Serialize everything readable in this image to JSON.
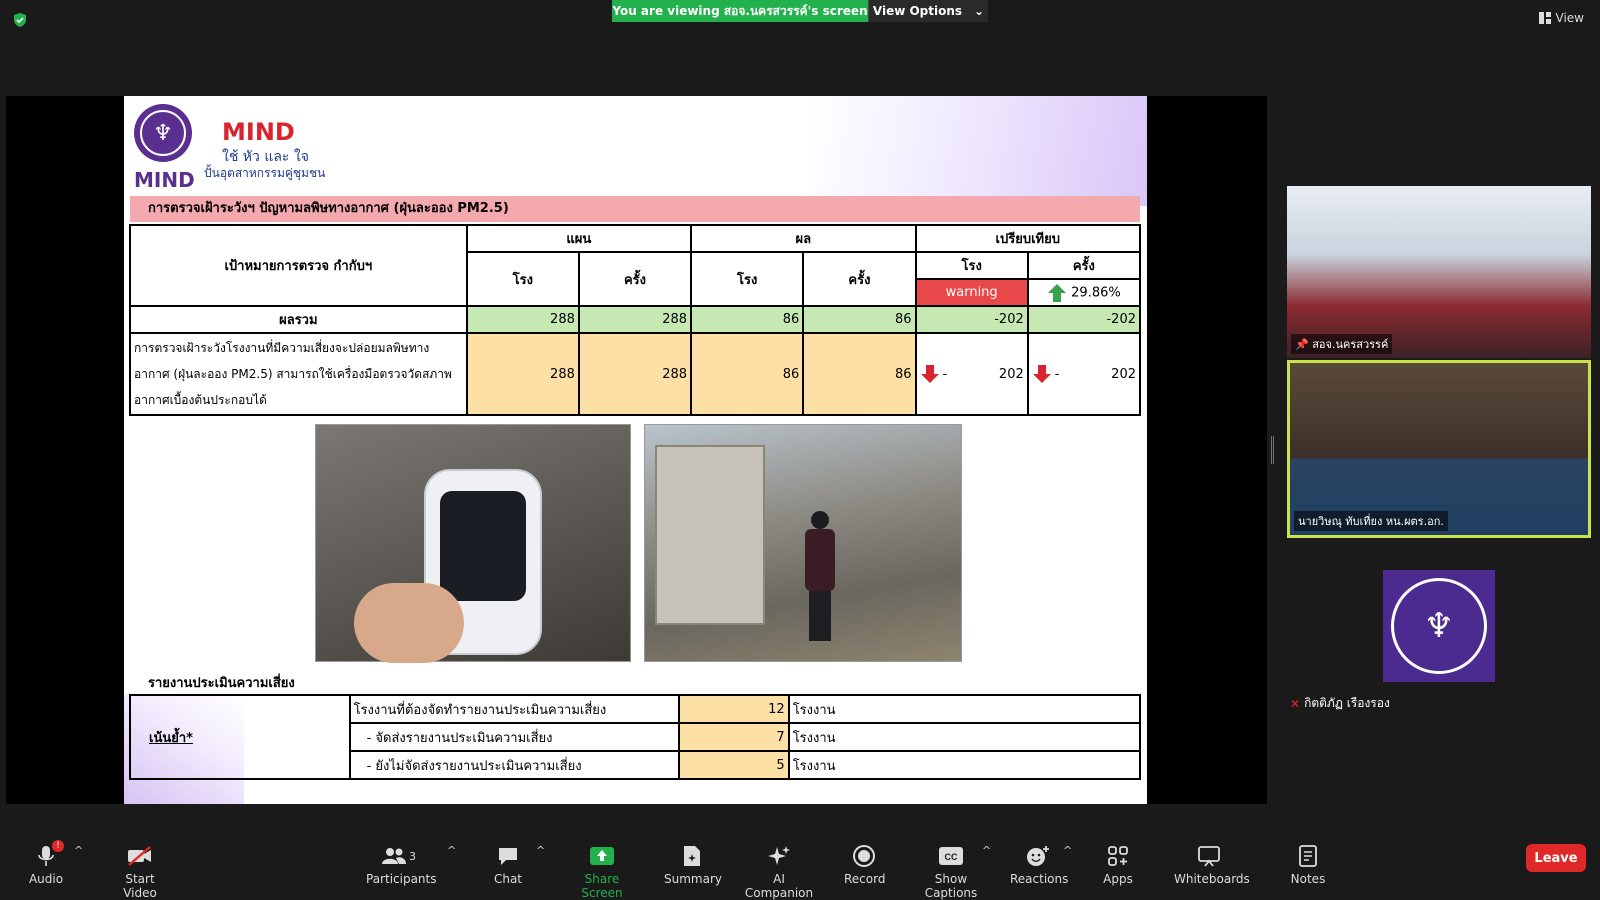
{
  "topbar": {
    "viewing_text": "You are viewing สอจ.นครสวรรค์'s screen",
    "view_options_label": "View Options",
    "view_label": "View"
  },
  "slide": {
    "logo_word": "MIND",
    "brand_title": "MIND",
    "brand_sub1": "ใช้ หัว และ ใจ",
    "brand_sub2": "ปั้นอุตสาหกรรมคู่ชุมชน",
    "section_title": "การตรวจเฝ้าระวังฯ ปัญหามลพิษทางอากาศ (ฝุ่นละออง PM2.5)",
    "table": {
      "target_header": "เป้าหมายการตรวจ กำกับฯ",
      "plan_header": "แผน",
      "result_header": "ผล",
      "compare_header": "เปรียบเทียบ",
      "col_factory": "โรง",
      "col_times": "ครั้ง",
      "compare_factory_status": "warning",
      "compare_times_pct": "29.86%",
      "total_label": "ผลรวม",
      "total_values": [
        "288",
        "288",
        "86",
        "86",
        "-202",
        "-202"
      ],
      "row_label": "การตรวจเฝ้าระวังโรงงานที่มีความเสี่ยงจะปล่อยมลพิษทางอากาศ (ฝุ่นละออง PM2.5) สามารถใช้เครื่องมือตรวจวัดสภาพอากาศเบื้องต้นประกอบได้",
      "row_values": [
        "288",
        "288",
        "86",
        "86"
      ],
      "row_compare_dash": "-",
      "row_compare_values": [
        "202",
        "202"
      ]
    },
    "risk_title": "รายงานประเมินความเสี่ยง",
    "risk_emphasis": "เน้นย้ำ*",
    "risk_rows": [
      {
        "label": "โรงงานที่ต้องจัดทำรายงานประเมินความเสี่ยง",
        "value": "12",
        "unit": "โรงงาน"
      },
      {
        "label": "- จัดส่งรายงานประเมินความเสี่ยง",
        "value": "7",
        "unit": "โรงงาน"
      },
      {
        "label": "- ยังไม่จัดส่งรายงานประเมินความเสี่ยง",
        "value": "5",
        "unit": "โรงงาน"
      }
    ]
  },
  "participants": {
    "tile1_name": "สอจ.นครสวรรค์",
    "tile2_name": "นายวิษณุ ทับเที่ยง หน.ผตร.อก.",
    "tile3_name": "กิตติภัฏ เรืองรอง"
  },
  "toolbar": {
    "audio": "Audio",
    "start_video": "Start Video",
    "participants": "Participants",
    "participants_count": "3",
    "chat": "Chat",
    "share_screen": "Share Screen",
    "summary": "Summary",
    "ai_companion": "AI Companion",
    "record": "Record",
    "show_captions": "Show Captions",
    "reactions": "Reactions",
    "apps": "Apps",
    "whiteboards": "Whiteboards",
    "notes": "Notes",
    "leave": "Leave",
    "audio_badge": "!"
  },
  "colors": {
    "share_green": "#22b14c",
    "leave_red": "#e02828",
    "active_speaker": "#c9e44a",
    "section_pink": "#f3a9ae",
    "total_green": "#c6e8b3",
    "row_peach": "#fde0a6",
    "warning_red": "#e9484a"
  },
  "icons": {
    "shield": "shield-icon",
    "view": "view-grid-icon",
    "audio": "microphone-icon",
    "video": "video-off-icon",
    "participants": "participants-icon",
    "chat": "chat-icon",
    "share": "share-screen-icon",
    "summary": "summary-icon",
    "ai": "ai-companion-icon",
    "record": "record-icon",
    "captions": "captions-icon",
    "reactions": "reactions-icon",
    "apps": "apps-icon",
    "whiteboards": "whiteboard-icon",
    "notes": "notes-icon"
  }
}
